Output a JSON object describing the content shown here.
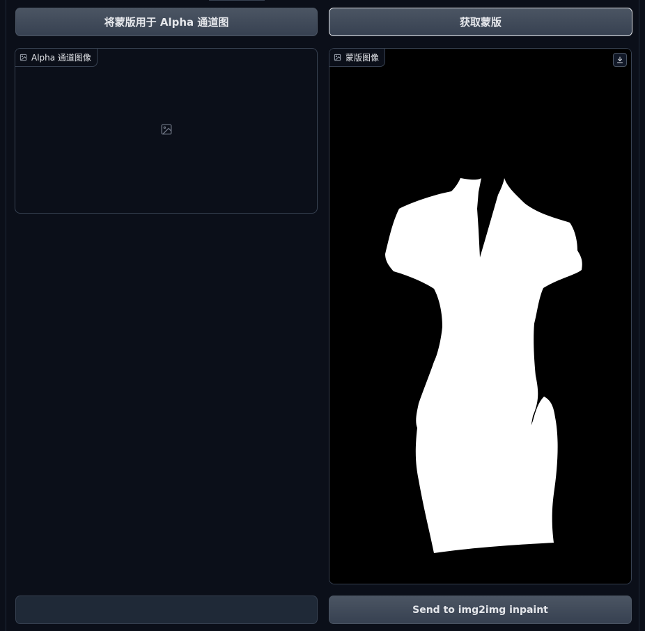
{
  "left": {
    "apply_button_label": "将蒙版用于 Alpha 通道图",
    "alpha_panel_label": "Alpha 通道图像",
    "alpha_placeholder_icon": "image-icon",
    "bottom_button_label": ""
  },
  "right": {
    "get_mask_button_label": "获取蒙版",
    "mask_panel_label": "蒙版图像",
    "download_icon": "download-icon",
    "send_button_label": "Send to img2img inpaint"
  },
  "colors": {
    "background": "#0b0f19",
    "panel_border": "#374151",
    "button_gradient_top": "#4b5563",
    "button_gradient_bottom": "#374151",
    "text": "#e5e7eb",
    "mask_background": "#000000",
    "mask_foreground": "#ffffff"
  }
}
